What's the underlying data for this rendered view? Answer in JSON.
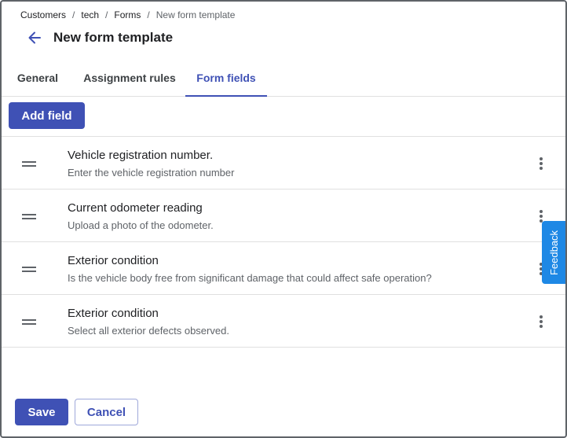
{
  "breadcrumb": {
    "items": [
      "Customers",
      "tech",
      "Forms",
      "New form template"
    ],
    "separator": "/"
  },
  "header": {
    "back_icon": "arrow-left-icon",
    "title": "New form template"
  },
  "tabs": [
    {
      "label": "General",
      "active": false
    },
    {
      "label": "Assignment rules",
      "active": false
    },
    {
      "label": "Form fields",
      "active": true
    }
  ],
  "toolbar": {
    "add_field_label": "Add field"
  },
  "fields": [
    {
      "title": "Vehicle registration number.",
      "description": "Enter the vehicle registration number"
    },
    {
      "title": "Current odometer reading",
      "description": "Upload a photo of the odometer."
    },
    {
      "title": "Exterior condition",
      "description": "Is the vehicle body free from significant damage that could affect safe operation?"
    },
    {
      "title": "Exterior condition",
      "description": "Select all exterior defects observed."
    }
  ],
  "feedback": {
    "label": "Feedback"
  },
  "footer": {
    "save_label": "Save",
    "cancel_label": "Cancel"
  },
  "colors": {
    "primary": "#3f51b5",
    "feedback": "#1e88e5",
    "text_secondary": "#5f6368"
  }
}
